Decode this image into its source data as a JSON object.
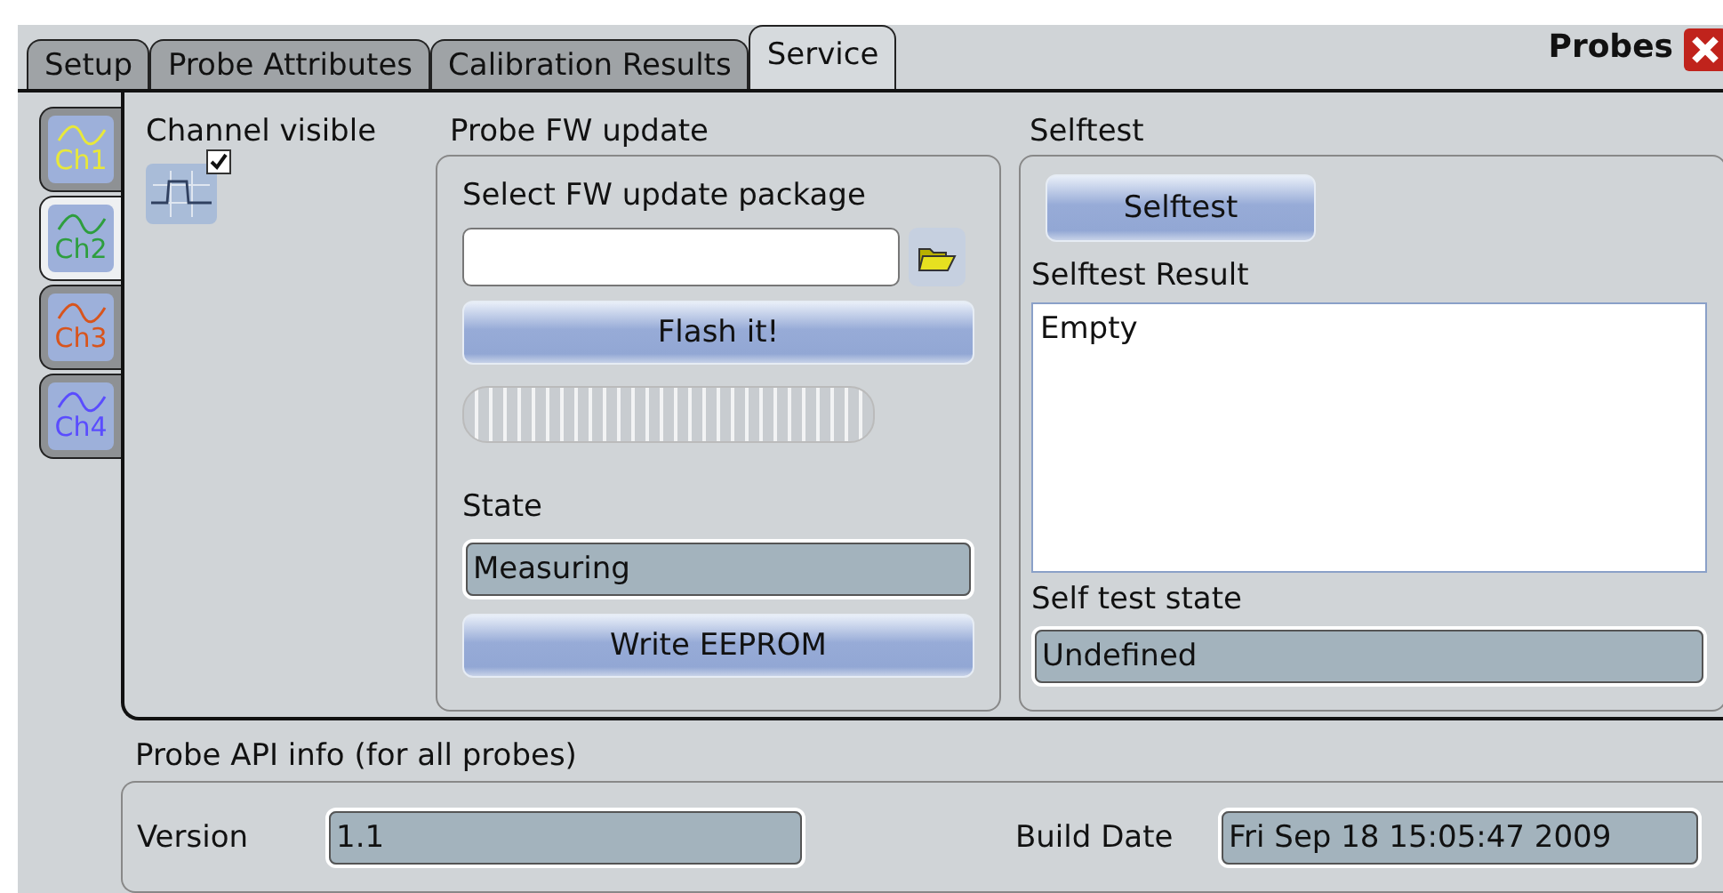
{
  "tabs": [
    {
      "label": "Setup",
      "selected": false
    },
    {
      "label": "Probe Attributes",
      "selected": false
    },
    {
      "label": "Calibration Results",
      "selected": false
    },
    {
      "label": "Service",
      "selected": true
    }
  ],
  "window": {
    "title": "Probes"
  },
  "channels": [
    {
      "label": "Ch1",
      "color": "#e8e83a",
      "selected": false
    },
    {
      "label": "Ch2",
      "color": "#2e9e3e",
      "selected": true
    },
    {
      "label": "Ch3",
      "color": "#d8541c",
      "selected": false
    },
    {
      "label": "Ch4",
      "color": "#5a4cff",
      "selected": false
    }
  ],
  "channel_visible": {
    "label": "Channel visible",
    "checked": true
  },
  "fw_update": {
    "title": "Probe FW update",
    "package_label": "Select FW update package",
    "flash_button": "Flash it!",
    "progress": {
      "level": 0
    },
    "state_label": "State",
    "state_value": "Measuring",
    "write_button": "Write EEPROM"
  },
  "selftest": {
    "title": "Selftest",
    "button": "Selftest",
    "result_label": "Selftest Result",
    "result_value": "Empty",
    "state_label": "Self test state",
    "state_value": "Undefined"
  },
  "api_info": {
    "title": "Probe API info (for all probes)",
    "version_label": "Version",
    "version_value": "1.1",
    "build_label": "Build Date",
    "build_value": "Fri Sep 18 15:05:47 2009"
  }
}
